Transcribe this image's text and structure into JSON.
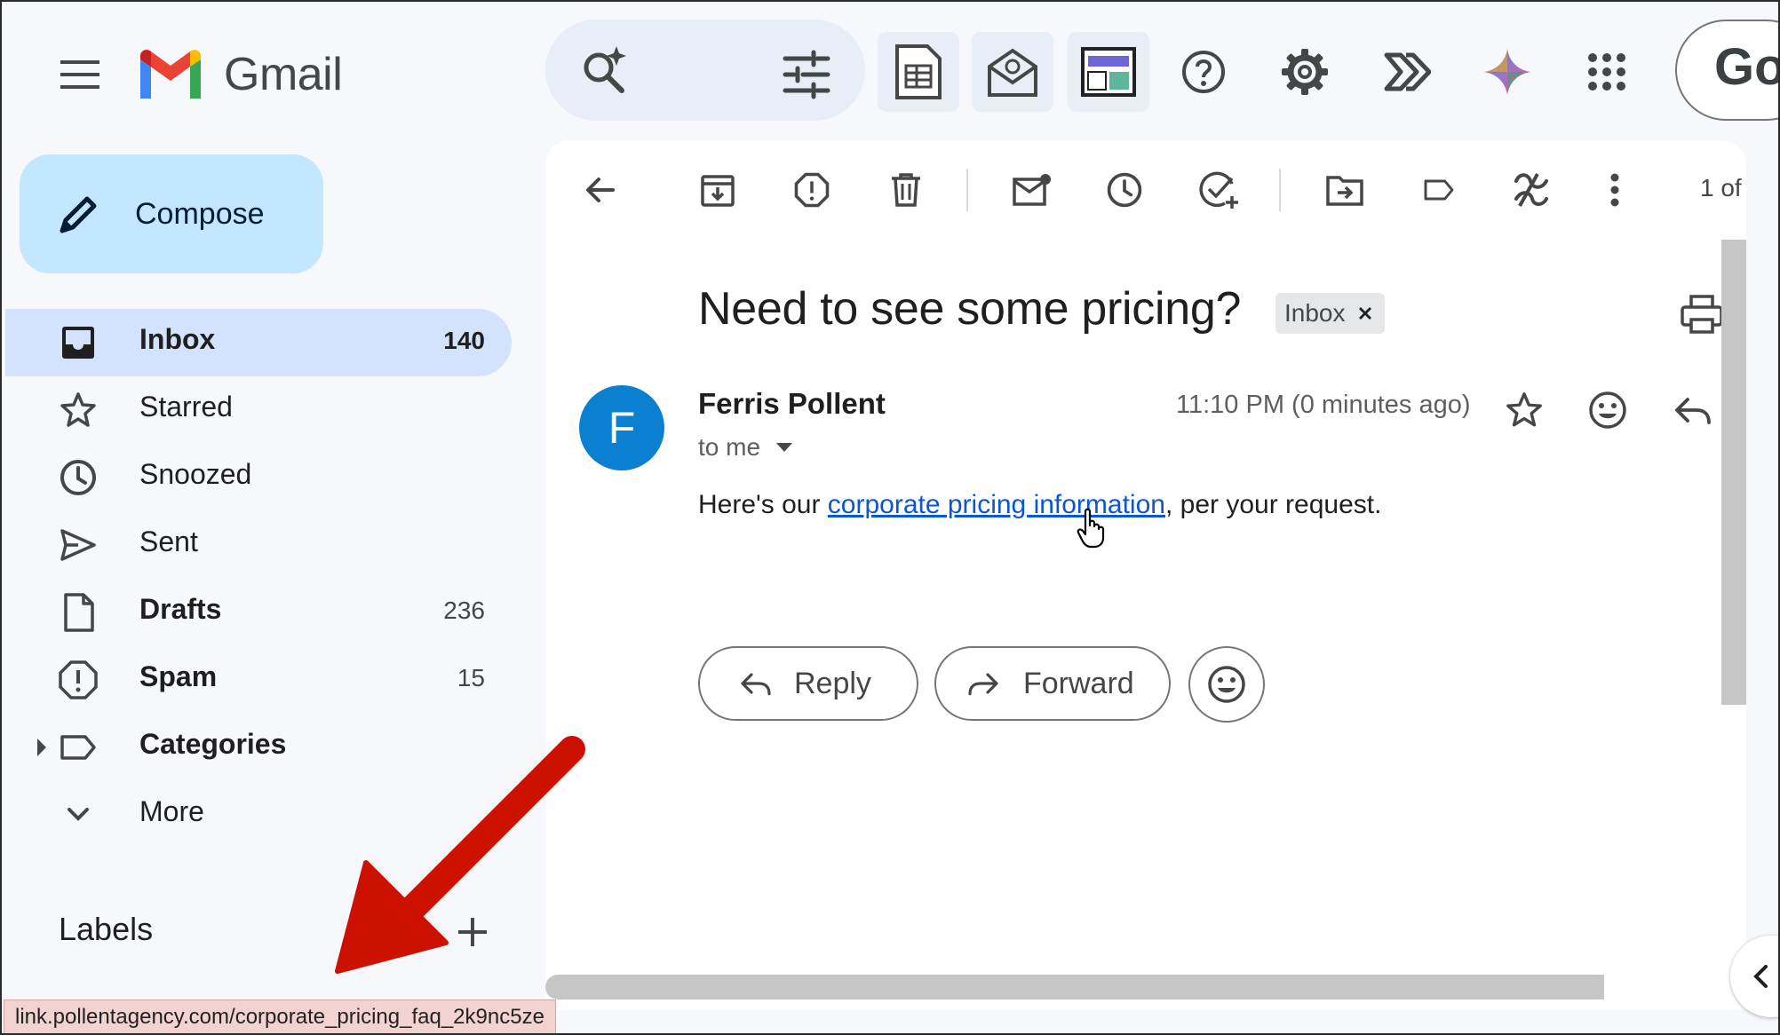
{
  "app": {
    "name": "Gmail"
  },
  "header": {
    "account_text": "Go"
  },
  "compose": {
    "label": "Compose"
  },
  "nav": {
    "items": [
      {
        "label": "Inbox",
        "count": "140"
      },
      {
        "label": "Starred",
        "count": ""
      },
      {
        "label": "Snoozed",
        "count": ""
      },
      {
        "label": "Sent",
        "count": ""
      },
      {
        "label": "Drafts",
        "count": "236"
      },
      {
        "label": "Spam",
        "count": "15"
      },
      {
        "label": "Categories",
        "count": ""
      },
      {
        "label": "More",
        "count": ""
      }
    ]
  },
  "labels": {
    "title": "Labels"
  },
  "toolbar": {
    "count": "1 of"
  },
  "email": {
    "subject": "Need to see some pricing?",
    "tag": "Inbox",
    "avatar_initial": "F",
    "sender": "Ferris Pollent",
    "recipient": "to me",
    "time": "11:10 PM (0 minutes ago)",
    "body_before": "Here's our ",
    "body_link": "corporate pricing information",
    "body_after": ", per your request."
  },
  "actions": {
    "reply": "Reply",
    "forward": "Forward"
  },
  "status_url": "link.pollentagency.com/corporate_pricing_faq_2k9nc5ze",
  "colors": {
    "compose_bg": "#c2e7ff",
    "active_nav": "#d3e3fd",
    "avatar": "#0b7fd0",
    "link": "#0b57d0",
    "annotation_arrow": "#cc1100"
  }
}
